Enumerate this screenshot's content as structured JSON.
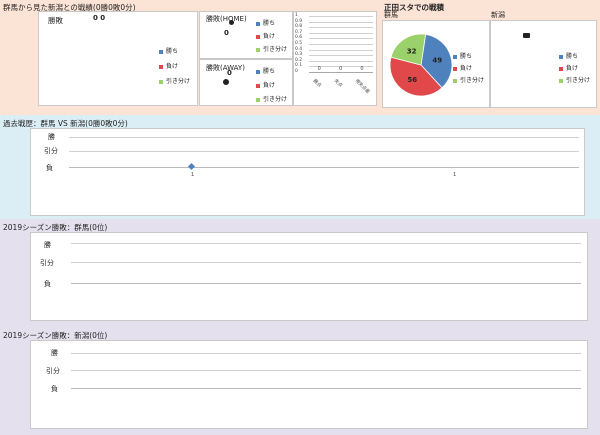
{
  "top_left": {
    "title": "群馬から見た新潟との戦績(0勝0敗0分)",
    "overall": {
      "label": "勝敗",
      "value": "0 0",
      "legend": [
        "勝ち",
        "負け",
        "引き分け"
      ]
    },
    "home": {
      "label": "勝敗(HOME)",
      "value": "0",
      "legend": [
        "勝ち",
        "負け",
        "引き分け"
      ]
    },
    "away": {
      "label": "勝敗(AWAY)",
      "value": "0",
      "legend": [
        "勝ち",
        "負け",
        "引き分け"
      ]
    },
    "bar_chart": {
      "y_ticks": [
        "1",
        "0.9",
        "0.8",
        "0.7",
        "0.6",
        "0.5",
        "0.4",
        "0.3",
        "0.2",
        "0.1",
        "0"
      ],
      "categories": [
        "勝点",
        "失点",
        "得失点差"
      ],
      "values": [
        0,
        0,
        0
      ]
    }
  },
  "top_right": {
    "title": "正田スタでの戦積",
    "gunma": {
      "label": "群馬",
      "legend": [
        "勝ち",
        "負け",
        "引き分け"
      ]
    },
    "niigata": {
      "label": "新潟",
      "legend": [
        "勝ち",
        "負け",
        "引き分け"
      ]
    }
  },
  "history": {
    "title": "過去戦歴：群馬 VS 新潟(0勝0敗0分)",
    "rows": [
      "勝",
      "引分",
      "負"
    ],
    "x_ticks": [
      "1",
      "1"
    ]
  },
  "season_gunma": {
    "title": "2019シーズン勝敗：群馬(0位)",
    "rows": [
      "勝",
      "引分",
      "負"
    ]
  },
  "season_niigata": {
    "title": "2019シーズン勝敗：新潟(0位)",
    "rows": [
      "勝",
      "引分",
      "負"
    ]
  },
  "colors": {
    "win": "#4f81bd",
    "loss": "#e0484a",
    "draw": "#9bd16b",
    "peach": "#fbe4d6",
    "blue": "#dceef5",
    "lavender": "#e5e0ee"
  },
  "chart_data": {
    "type": "pie",
    "categories": [
      "勝ち",
      "負け",
      "引き分け"
    ],
    "values": [
      49,
      56,
      32
    ],
    "title": "群馬"
  }
}
